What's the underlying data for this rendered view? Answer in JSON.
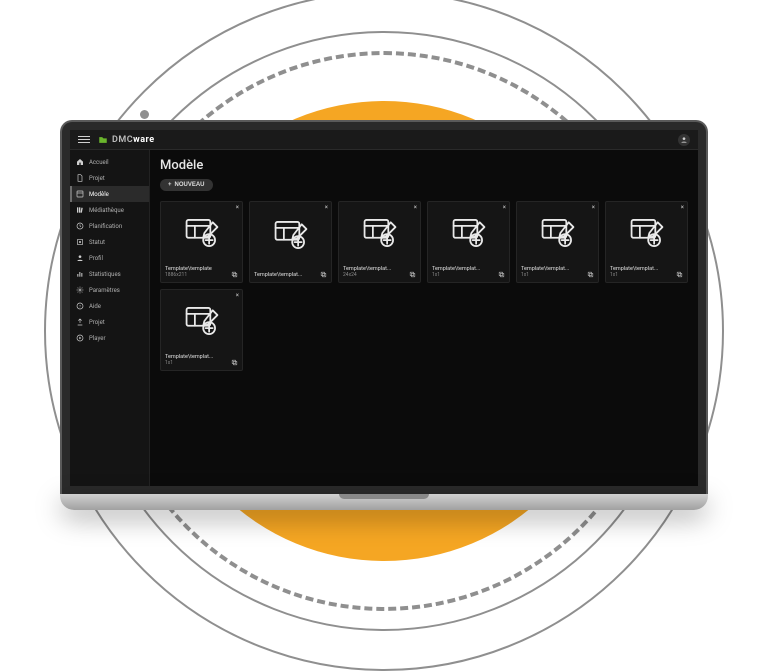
{
  "brand": {
    "prefix": "DMC",
    "suffix": "ware"
  },
  "page": {
    "title": "Modèle"
  },
  "actions": {
    "new_label": "NOUVEAU"
  },
  "sidebar": {
    "items": [
      {
        "key": "home",
        "label": "Accueil"
      },
      {
        "key": "project",
        "label": "Projet"
      },
      {
        "key": "model",
        "label": "Modèle",
        "active": true
      },
      {
        "key": "library",
        "label": "Médiathèque"
      },
      {
        "key": "planning",
        "label": "Planification"
      },
      {
        "key": "status",
        "label": "Statut"
      },
      {
        "key": "profile",
        "label": "Profil"
      },
      {
        "key": "stats",
        "label": "Statistiques"
      },
      {
        "key": "settings",
        "label": "Paramètres"
      },
      {
        "key": "help",
        "label": "Aide"
      },
      {
        "key": "project2",
        "label": "Projet"
      },
      {
        "key": "player",
        "label": "Player"
      }
    ]
  },
  "templates": [
    {
      "name": "Template\\template",
      "dim": "1886x211"
    },
    {
      "name": "Template\\templat...",
      "dim": ""
    },
    {
      "name": "Template\\templat...",
      "dim": "24x24"
    },
    {
      "name": "Template\\templat...",
      "dim": "1x1"
    },
    {
      "name": "Template\\templat...",
      "dim": "1x1"
    },
    {
      "name": "Template\\templat...",
      "dim": "1x1"
    },
    {
      "name": "Template\\templat...",
      "dim": "1x1"
    }
  ]
}
